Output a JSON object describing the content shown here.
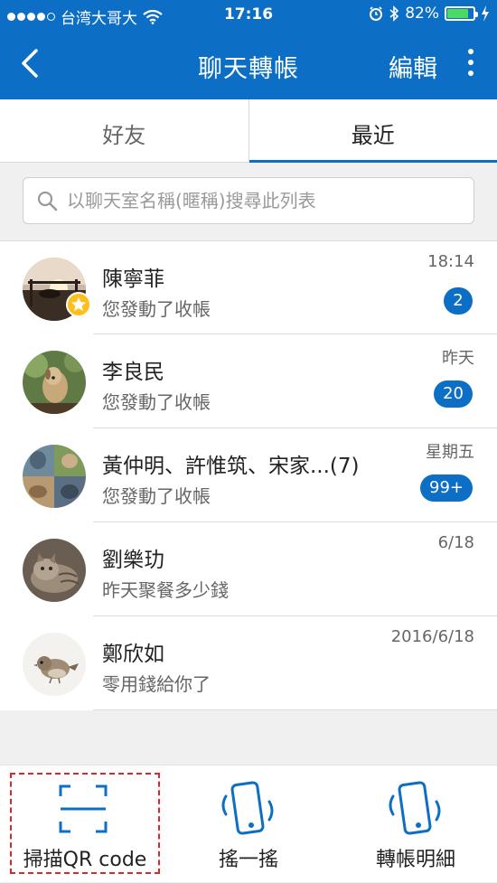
{
  "status_bar": {
    "carrier": "台湾大哥大",
    "time": "17:16",
    "battery": "82%",
    "battery_level": 0.82
  },
  "nav": {
    "title": "聊天轉帳",
    "edit_label": "編輯",
    "back_icon": "chevron-left-icon",
    "more_icon": "more-vertical-icon"
  },
  "tabs": [
    {
      "label": "好友",
      "active": false
    },
    {
      "label": "最近",
      "active": true
    }
  ],
  "search": {
    "placeholder": "以聊天室名稱(暱稱)搜尋此列表"
  },
  "chats": [
    {
      "name": "陳寧菲",
      "message": "您發動了收帳",
      "time": "18:14",
      "badge": "2",
      "starred": true
    },
    {
      "name": "李良民",
      "message": "您發動了收帳",
      "time": "昨天",
      "badge": "20",
      "starred": false
    },
    {
      "name": "黃仲明、許惟筑、宋家...(7)",
      "message": "您發動了收帳",
      "time": "星期五",
      "badge": "99+",
      "starred": false
    },
    {
      "name": "劉樂玏",
      "message": "昨天聚餐多少錢",
      "time": "6/18",
      "badge": "",
      "starred": false
    },
    {
      "name": "鄭欣如",
      "message": "零用錢給你了",
      "time": "2016/6/18",
      "badge": "",
      "starred": false
    }
  ],
  "bottom_bar": {
    "scan_label": "掃描QR code",
    "shake_label": "搖一搖",
    "history_label": "轉帳明細"
  },
  "colors": {
    "primary": "#0c6fc5",
    "highlight_dashed": "#d9272e",
    "star": "#ffbf1a"
  }
}
